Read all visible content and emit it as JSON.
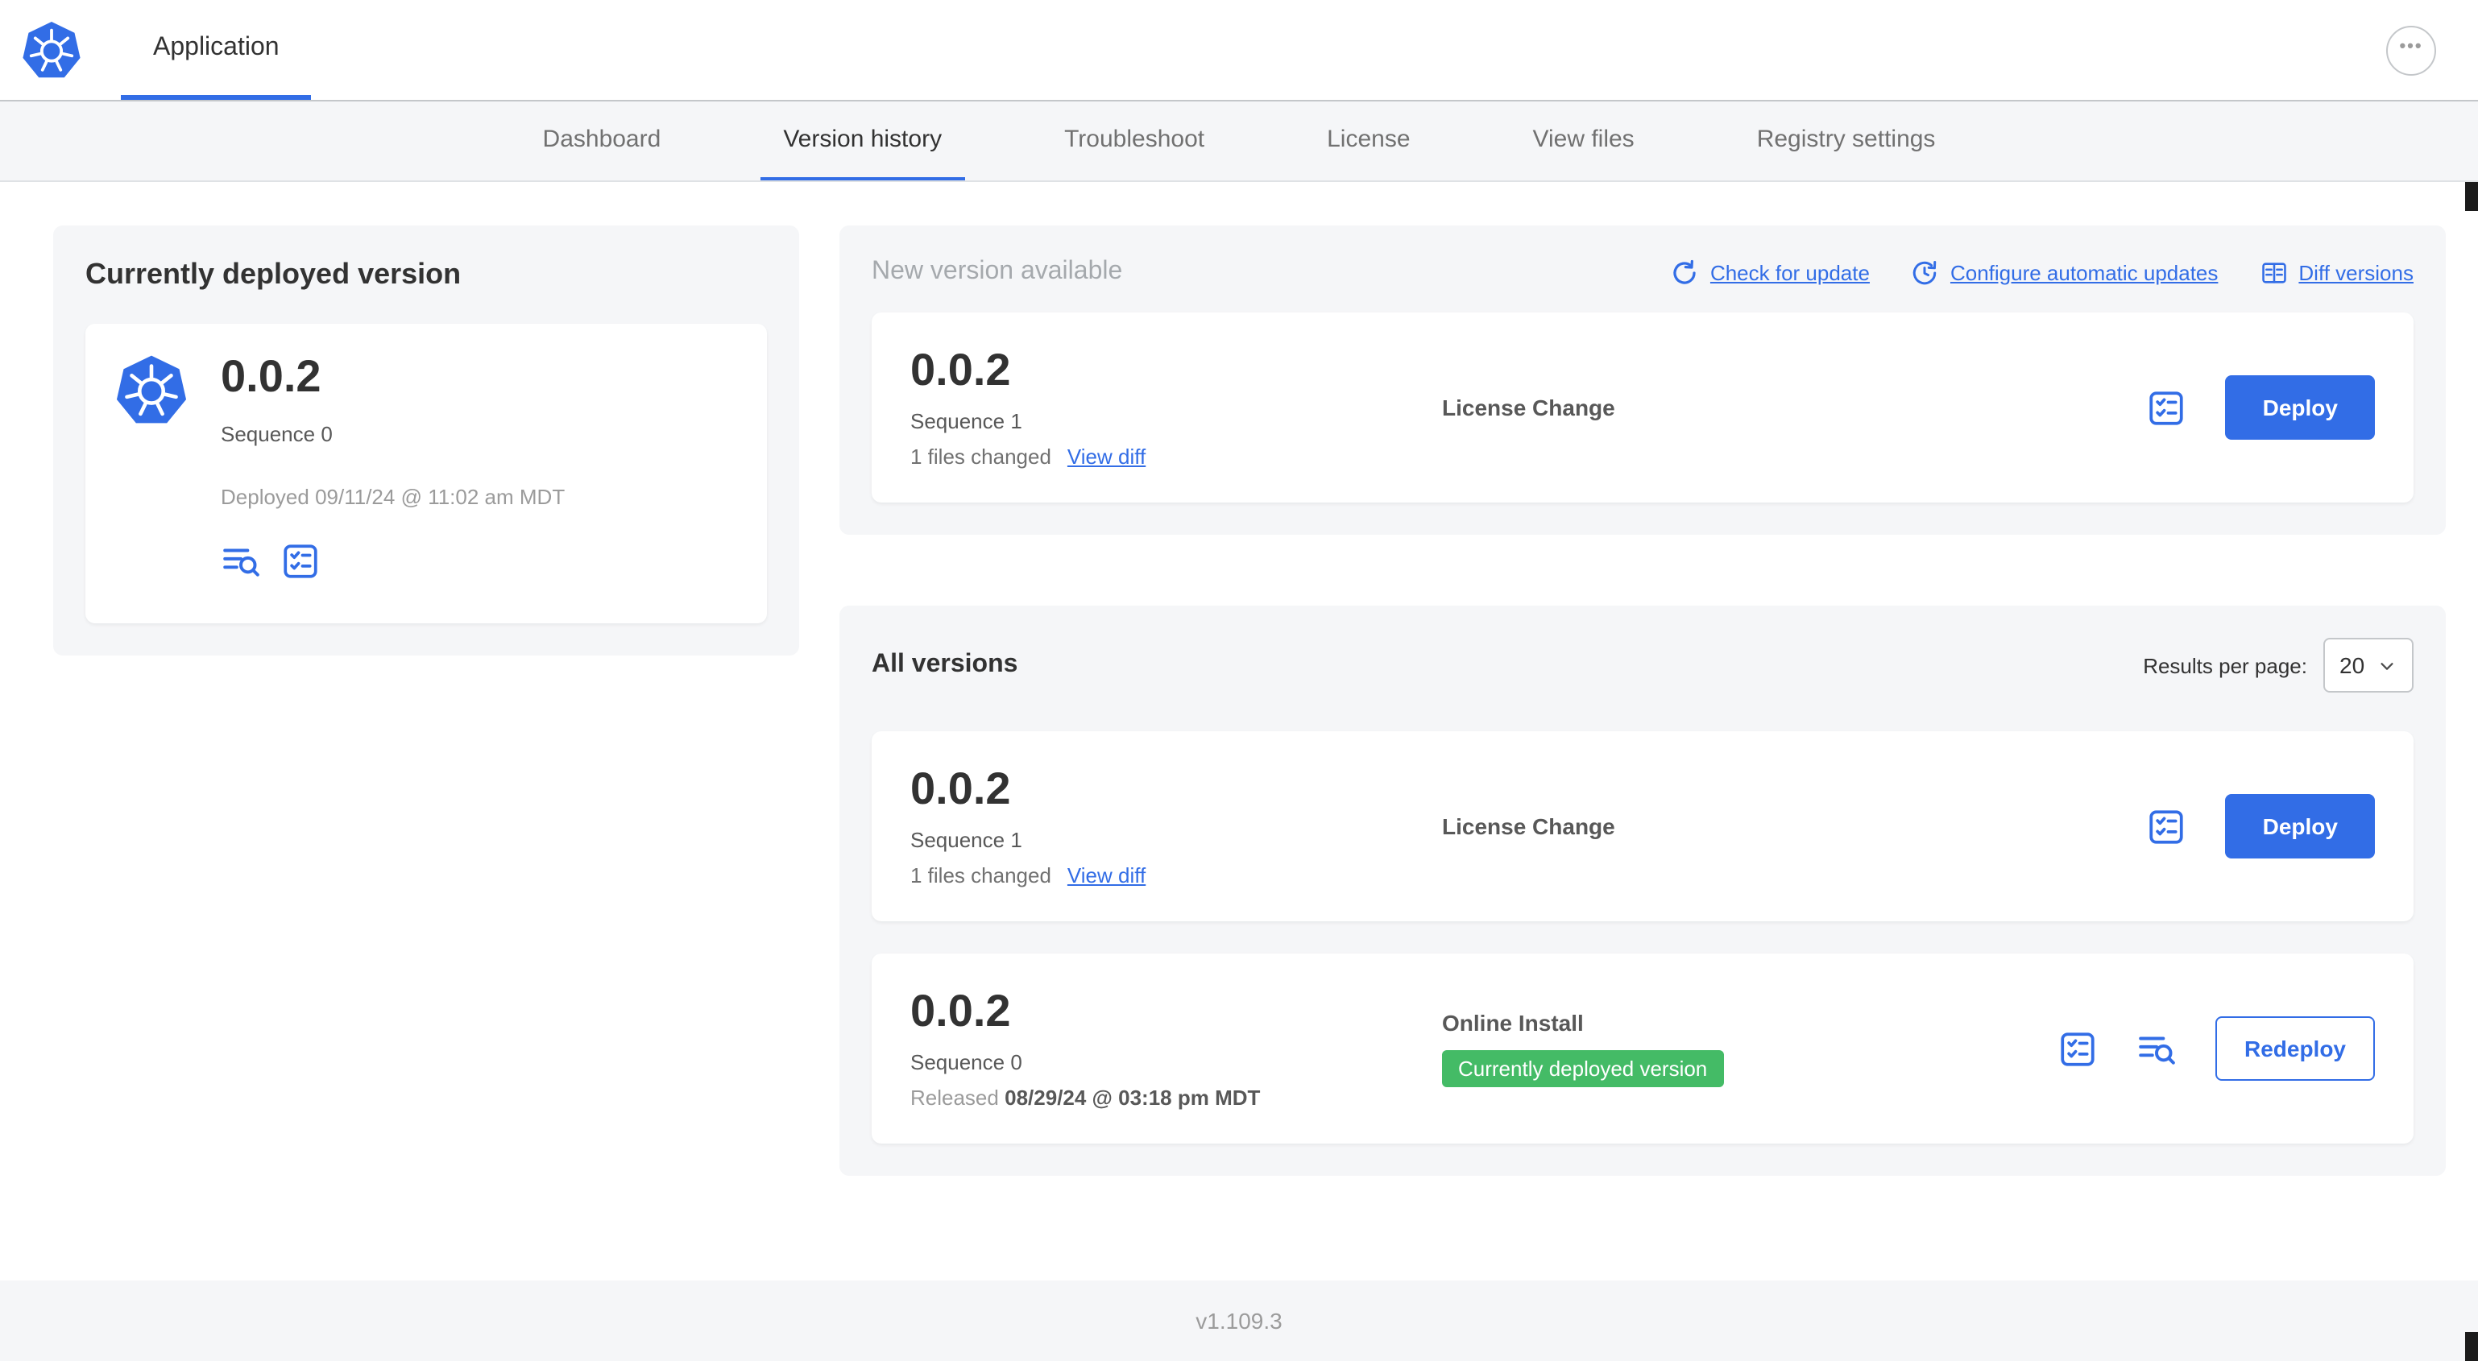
{
  "header": {
    "app_tab": "Application",
    "menu_glyph": "•••"
  },
  "nav": {
    "tabs": [
      "Dashboard",
      "Version history",
      "Troubleshoot",
      "License",
      "View files",
      "Registry settings"
    ],
    "active": "Version history"
  },
  "current": {
    "title": "Currently deployed version",
    "version": "0.0.2",
    "sequence": "Sequence 0",
    "deployed": "Deployed 09/11/24 @ 11:02 am MDT"
  },
  "new_version": {
    "title": "New version available",
    "actions": {
      "check": "Check for update",
      "auto": "Configure automatic updates",
      "diff": "Diff versions"
    },
    "row": {
      "version": "0.0.2",
      "sequence": "Sequence 1",
      "files_changed": "1 files changed",
      "view_diff": "View diff",
      "source": "License Change",
      "action": "Deploy"
    }
  },
  "all_versions": {
    "title": "All versions",
    "results_per_page_label": "Results per page:",
    "results_per_page_value": "20",
    "rows": [
      {
        "version": "0.0.2",
        "sequence": "Sequence 1",
        "files_changed": "1 files changed",
        "view_diff": "View diff",
        "source": "License Change",
        "action": "Deploy"
      },
      {
        "version": "0.0.2",
        "sequence": "Sequence 0",
        "released_label": "Released",
        "released_date": "08/29/24 @ 03:18 pm MDT",
        "source": "Online Install",
        "badge": "Currently deployed version",
        "action": "Redeploy"
      }
    ]
  },
  "footer": {
    "version": "v1.109.3"
  },
  "colors": {
    "primary": "#326de6",
    "success": "#44bb66",
    "card_bg": "#f5f6f8"
  }
}
